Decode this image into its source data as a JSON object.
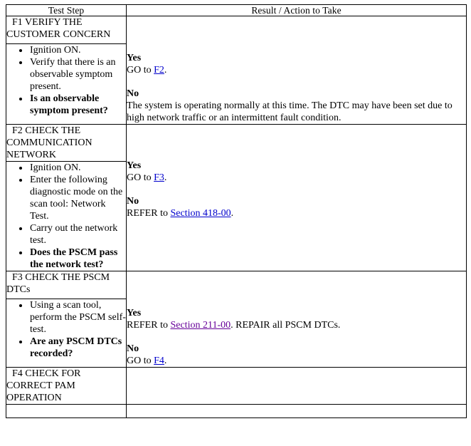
{
  "table": {
    "columns": [
      {
        "label": "Test Step"
      },
      {
        "label": "Result / Action to Take"
      }
    ],
    "rows": [
      {
        "id": "F1",
        "title": "F1 VERIFY THE CUSTOMER CONCERN",
        "steps": [
          {
            "text": "Ignition ON.",
            "bold": false
          },
          {
            "text": "Verify that there is an observable symptom present.",
            "bold": false
          },
          {
            "text": "Is an observable symptom present?",
            "bold": true
          }
        ],
        "results": [
          {
            "branch": "Yes",
            "prefix": "GO to ",
            "link": "F2",
            "link_visited": false,
            "suffix": "."
          },
          {
            "branch": "No",
            "prefix": "The system is operating normally at this time. The DTC may have been set due to high network traffic or an intermittent fault condition.",
            "link": "",
            "link_visited": false,
            "suffix": ""
          }
        ]
      },
      {
        "id": "F2",
        "title": "F2 CHECK THE COMMUNICATION NETWORK",
        "steps": [
          {
            "text": "Ignition ON.",
            "bold": false
          },
          {
            "text": "Enter the following diagnostic mode on the scan tool: Network Test.",
            "bold": false
          },
          {
            "text": "Carry out the network test.",
            "bold": false
          },
          {
            "text": "Does the PSCM pass the network test?",
            "bold": true
          }
        ],
        "results": [
          {
            "branch": "Yes",
            "prefix": "GO to ",
            "link": "F3",
            "link_visited": false,
            "suffix": "."
          },
          {
            "branch": "No",
            "prefix": "REFER to ",
            "link": "Section 418-00",
            "link_visited": false,
            "suffix": "."
          }
        ]
      },
      {
        "id": "F3",
        "title": "F3 CHECK THE PSCM DTCs",
        "steps": [
          {
            "text": "Using a scan tool, perform the PSCM self-test.",
            "bold": false
          },
          {
            "text": "Are any PSCM DTCs recorded?",
            "bold": true
          }
        ],
        "results": [
          {
            "branch": "Yes",
            "prefix": "REFER to ",
            "link": "Section 211-00",
            "link_visited": true,
            "suffix": ". REPAIR all PSCM DTCs."
          },
          {
            "branch": "No",
            "prefix": "GO to ",
            "link": "F4",
            "link_visited": false,
            "suffix": "."
          }
        ]
      },
      {
        "id": "F4",
        "title": "F4 CHECK FOR CORRECT PAM OPERATION",
        "steps": [],
        "results": []
      }
    ]
  }
}
